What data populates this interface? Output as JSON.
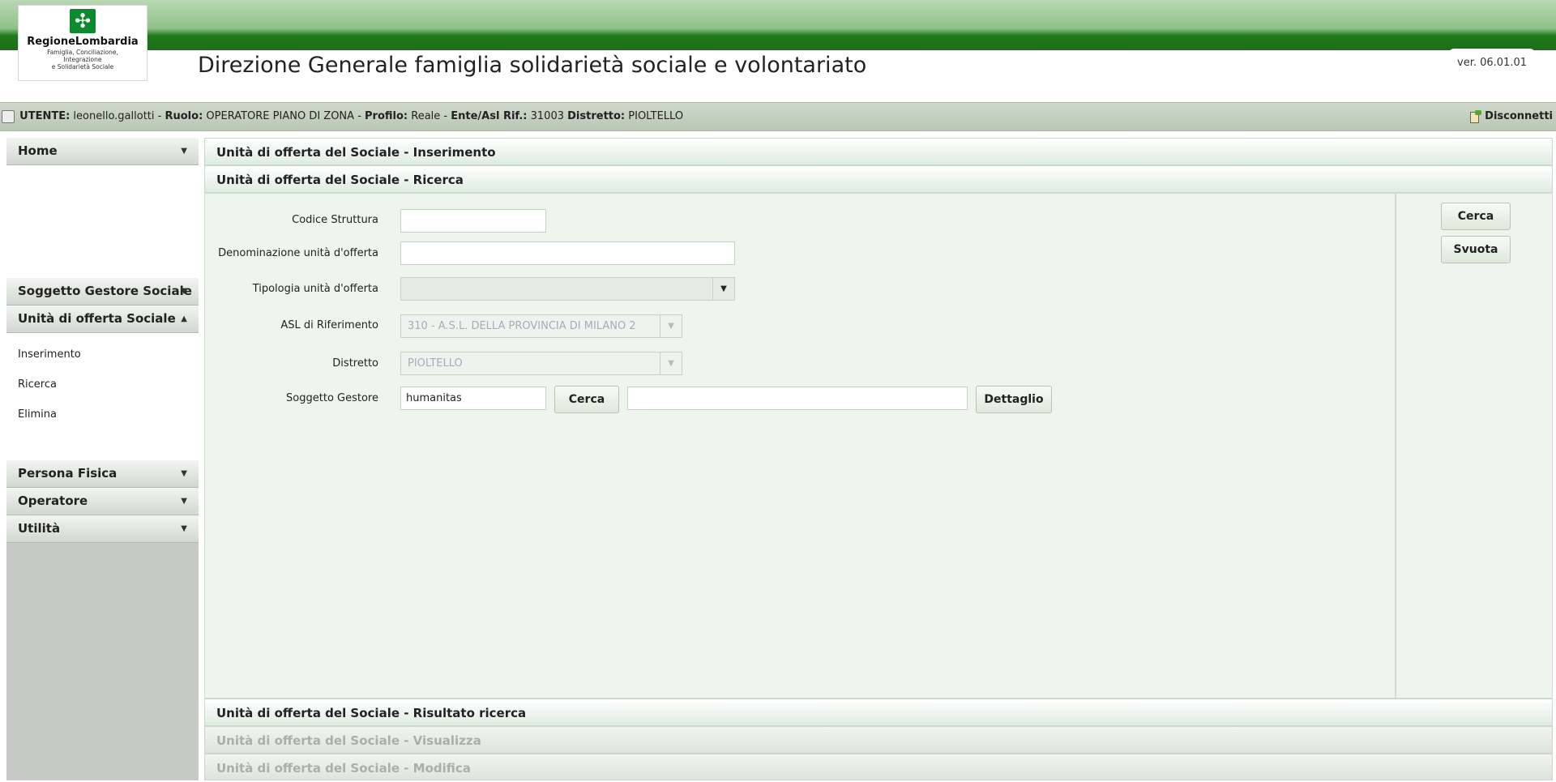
{
  "header": {
    "logo_name": "RegioneLombardia",
    "logo_subtitle": [
      "Famiglia, Conciliazione,",
      "Integrazione",
      "e Solidarietà Sociale"
    ],
    "title": "Direzione Generale famiglia solidarietà sociale e volontariato",
    "version": "ver. 06.01.01"
  },
  "userbar": {
    "utente_label": "UTENTE:",
    "utente": "leonello.gallotti",
    "ruolo_label": "Ruolo:",
    "ruolo": "OPERATORE PIANO DI ZONA",
    "profilo_label": "Profilo:",
    "profilo": "Reale",
    "ente_label": "Ente/Asl Rif.:",
    "ente": "31003",
    "distretto_label": "Distretto:",
    "distretto": "PIOLTELLO",
    "disconnect": "Disconnetti"
  },
  "sidebar": {
    "home": "Home",
    "soggetto": "Soggetto Gestore Sociale",
    "unita": "Unità di offerta Sociale",
    "unita_items": [
      "Inserimento",
      "Ricerca",
      "Elimina"
    ],
    "persona": "Persona Fisica",
    "operatore": "Operatore",
    "utilita": "Utilità"
  },
  "sections": {
    "inserimento": "Unità di offerta del Sociale - Inserimento",
    "ricerca": "Unità di offerta del Sociale - Ricerca",
    "risultato": "Unità di offerta del Sociale - Risultato ricerca",
    "visualizza": "Unità di offerta del Sociale - Visualizza",
    "modifica": "Unità di offerta del Sociale - Modifica"
  },
  "form": {
    "codice_label": "Codice Struttura",
    "codice_value": "",
    "denominazione_label": "Denominazione unità d'offerta",
    "denominazione_value": "",
    "tipologia_label": "Tipologia unità d'offerta",
    "tipologia_value": "",
    "asl_label": "ASL di Riferimento",
    "asl_value": "310 - A.S.L. DELLA PROVINCIA DI MILANO 2",
    "distretto_label": "Distretto",
    "distretto_value": "PIOLTELLO",
    "soggetto_label": "Soggetto Gestore",
    "soggetto_value": "humanitas",
    "soggetto_desc": "",
    "cerca_inline": "Cerca",
    "dettaglio": "Dettaglio"
  },
  "actions": {
    "cerca": "Cerca",
    "svuota": "Svuota"
  }
}
